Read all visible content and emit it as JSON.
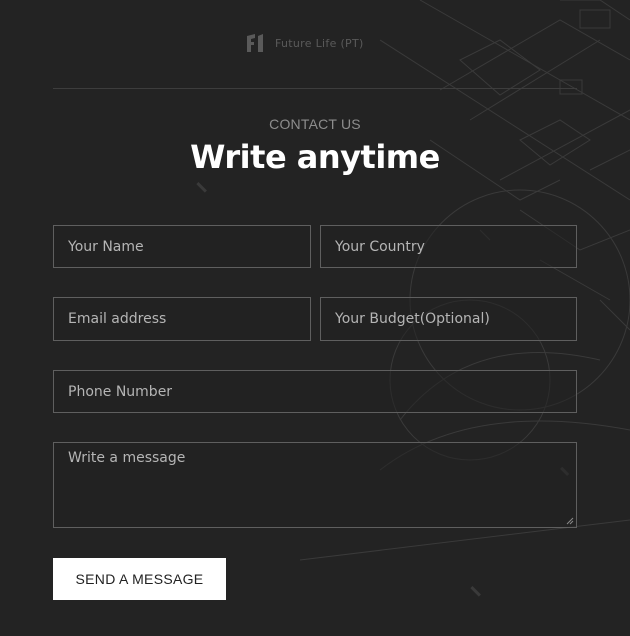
{
  "brand": {
    "logo_icon": "f1-logo-icon",
    "name": "Future Life (PT)"
  },
  "header": {
    "eyebrow": "CONTACT US",
    "title": "Write anytime"
  },
  "form": {
    "name_placeholder": "Your Name",
    "country_placeholder": "Your Country",
    "email_placeholder": "Email address",
    "budget_placeholder": "Your Budget(Optional)",
    "phone_placeholder": "Phone Number",
    "message_placeholder": "Write a message",
    "submit_label": "SEND A MESSAGE"
  },
  "colors": {
    "background": "#232323",
    "field_border": "#5f5f5f",
    "title": "#ffffff",
    "eyebrow": "#8d8d8d",
    "button_bg": "#ffffff",
    "button_text": "#222222"
  }
}
